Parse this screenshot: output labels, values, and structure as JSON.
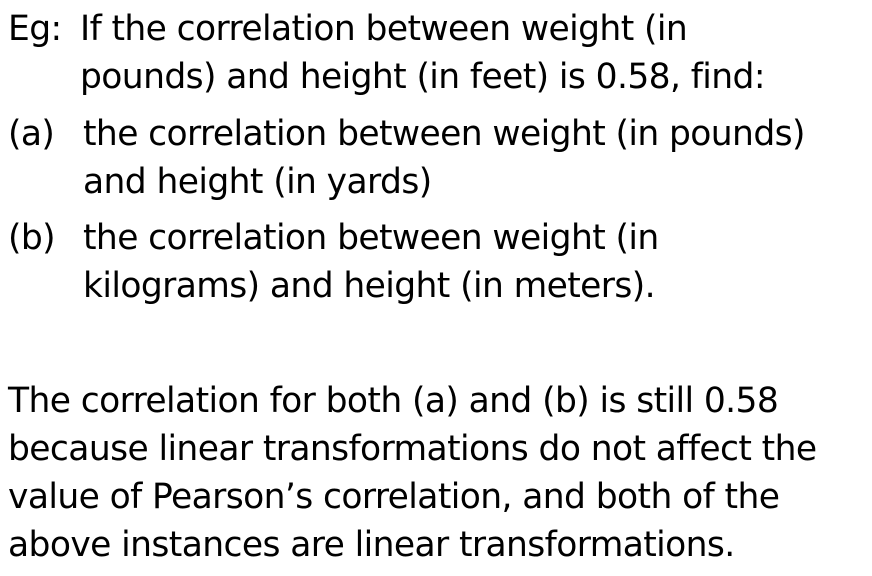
{
  "question": {
    "lead": "Eg:",
    "line1": "If the correlation between weight (in",
    "line2": "pounds) and height (in feet) is 0.58, find:",
    "parts": [
      {
        "label": "(a)",
        "line1": "the correlation between weight (in pounds)",
        "line2": "and height (in yards)"
      },
      {
        "label": "(b)",
        "line1": "the correlation between weight (in",
        "line2": "kilograms) and height (in meters)."
      }
    ]
  },
  "answer": {
    "lines": [
      "The correlation for both (a) and (b) is still 0.58",
      "because linear transformations do not affect the",
      "value of Pearson’s correlation, and both of the",
      "above instances are linear transformations."
    ]
  }
}
